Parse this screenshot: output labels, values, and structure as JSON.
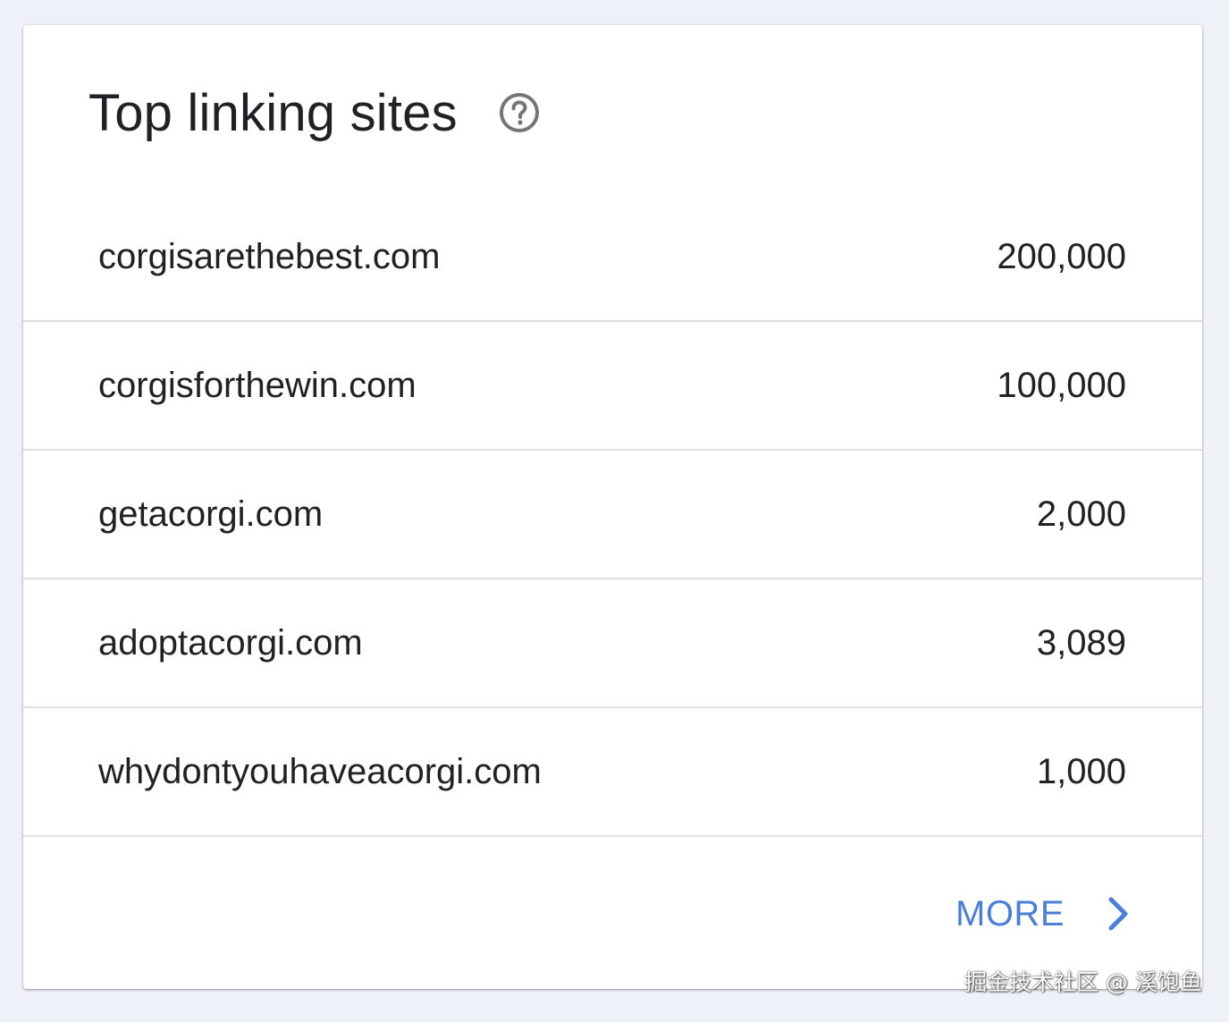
{
  "card": {
    "title": "Top linking sites",
    "help_icon": "help-circle-icon"
  },
  "sites": [
    {
      "domain": "corgisarethebest.com",
      "count": "200,000"
    },
    {
      "domain": "corgisforthewin.com",
      "count": "100,000"
    },
    {
      "domain": "getacorgi.com",
      "count": "2,000"
    },
    {
      "domain": "adoptacorgi.com",
      "count": "3,089"
    },
    {
      "domain": "whydontyouhaveacorgi.com",
      "count": "1,000"
    }
  ],
  "more": {
    "label": "MORE",
    "icon": "chevron-right-icon"
  },
  "watermark": "掘金技术社区 @ 溪饱鱼",
  "colors": {
    "accent": "#4a7fd9",
    "text": "#202124",
    "divider": "#e0e0e0",
    "icon": "#757575",
    "background": "#eef2f8"
  }
}
